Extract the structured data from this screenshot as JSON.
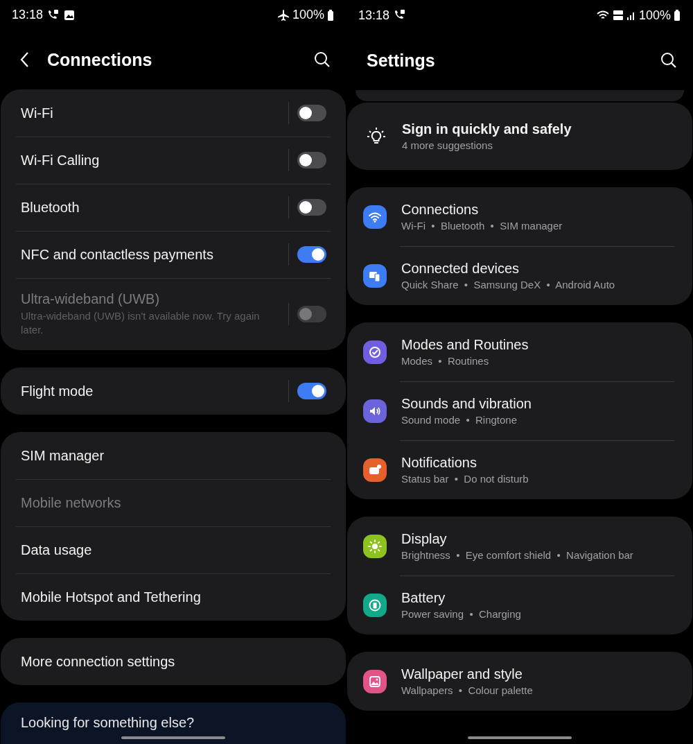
{
  "screens": [
    {
      "kind": "sub",
      "status_bar": {
        "time": "13:18",
        "battery": "100%"
      },
      "title": "Connections",
      "groups": [
        {
          "rows": [
            {
              "kind": "toggle",
              "label": "Wi-Fi",
              "on": false,
              "disabled": false
            },
            {
              "kind": "toggle",
              "label": "Wi-Fi Calling",
              "on": false,
              "disabled": false
            },
            {
              "kind": "toggle",
              "label": "Bluetooth",
              "on": false,
              "disabled": false
            },
            {
              "kind": "toggle",
              "label": "NFC and contactless payments",
              "on": true,
              "disabled": false
            },
            {
              "kind": "toggle",
              "label": "Ultra-wideband (UWB)",
              "description": "Ultra-wideband (UWB) isn't available now. Try again later.",
              "on": false,
              "disabled": true
            }
          ]
        },
        {
          "rows": [
            {
              "kind": "toggle",
              "label": "Flight mode",
              "on": true,
              "disabled": false
            }
          ]
        },
        {
          "rows": [
            {
              "kind": "link",
              "label": "SIM manager",
              "disabled": false
            },
            {
              "kind": "link",
              "label": "Mobile networks",
              "disabled": true
            },
            {
              "kind": "link",
              "label": "Data usage",
              "disabled": false
            },
            {
              "kind": "link",
              "label": "Mobile Hotspot and Tethering",
              "disabled": false
            }
          ]
        },
        {
          "rows": [
            {
              "kind": "link",
              "label": "More connection settings",
              "disabled": false
            }
          ]
        },
        {
          "kind": "hint",
          "rows": [
            {
              "kind": "hint",
              "label": "Looking for something else?"
            }
          ]
        }
      ]
    },
    {
      "kind": "main",
      "status_bar": {
        "time": "13:18",
        "battery": "100%"
      },
      "title": "Settings",
      "groups": [
        {
          "rows": [
            {
              "kind": "suggestion",
              "label": "Sign in quickly and safely",
              "sub": "4 more suggestions"
            }
          ]
        },
        {
          "rows": [
            {
              "kind": "menu",
              "label": "Connections",
              "sub": "Wi-Fi  •  Bluetooth  •  SIM manager",
              "color": "#3d7cf2"
            },
            {
              "kind": "menu",
              "label": "Connected devices",
              "sub": "Quick Share  •  Samsung DeX  •  Android Auto",
              "color": "#3d7cf2"
            }
          ]
        },
        {
          "rows": [
            {
              "kind": "menu",
              "label": "Modes and Routines",
              "sub": "Modes  •  Routines",
              "color": "#6f5fe0"
            },
            {
              "kind": "menu",
              "label": "Sounds and vibration",
              "sub": "Sound mode  •  Ringtone",
              "color": "#6a63dc"
            },
            {
              "kind": "menu",
              "label": "Notifications",
              "sub": "Status bar  •  Do not disturb",
              "color": "#e5602c"
            }
          ]
        },
        {
          "rows": [
            {
              "kind": "menu",
              "label": "Display",
              "sub": "Brightness  •  Eye comfort shield  •  Navigation bar",
              "color": "#8dc21f"
            },
            {
              "kind": "menu",
              "label": "Battery",
              "sub": "Power saving  •  Charging",
              "color": "#12a88a"
            }
          ]
        },
        {
          "rows": [
            {
              "kind": "menu",
              "label": "Wallpaper and style",
              "sub": "Wallpapers  •  Colour palette",
              "color": "#e2538a"
            }
          ]
        }
      ]
    }
  ]
}
